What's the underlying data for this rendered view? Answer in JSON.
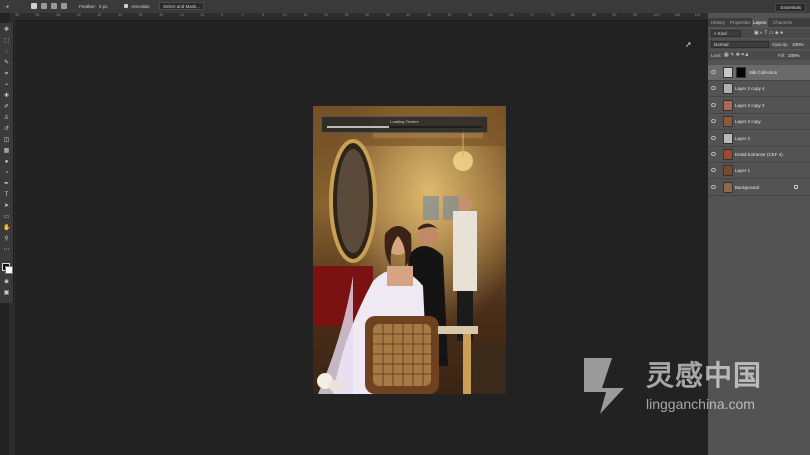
{
  "options_bar": {
    "feather_label": "Feather:",
    "feather_value": "0 px",
    "anti_alias_label": "Anti-alias",
    "select_mask_label": "Select and Mask..."
  },
  "workspace": {
    "label": "Essentials"
  },
  "ruler": {
    "top_numbers": [
      "35",
      "50",
      "45",
      "40",
      "35",
      "30",
      "25",
      "20",
      "15",
      "10",
      "5",
      "0",
      "5",
      "10",
      "15",
      "20",
      "25",
      "30",
      "35",
      "40",
      "45",
      "50",
      "55",
      "60",
      "65",
      "70",
      "75",
      "80",
      "85",
      "90",
      "95",
      "100",
      "105",
      "110"
    ]
  },
  "loading": {
    "label": "Loading Texture",
    "progress": 0.4
  },
  "panel": {
    "tabs": [
      "History",
      "Properties",
      "Layers",
      "Channels"
    ],
    "active_tab": "Layers",
    "kind_label": "Kind",
    "blend_mode": "Normal",
    "opacity_label": "Opacity:",
    "opacity_value": "100%",
    "lock_label": "Lock:",
    "fill_label": "Fill:",
    "fill_value": "100%",
    "layers": [
      {
        "name": "Silk Collection",
        "selected": true,
        "thumb": "#c8c8c8"
      },
      {
        "name": "Layer 2 copy 4",
        "selected": false,
        "thumb": "#b0b0b0"
      },
      {
        "name": "Layer 2 copy 3",
        "selected": false,
        "thumb": "#a86a5a"
      },
      {
        "name": "Layer 2 copy",
        "selected": false,
        "thumb": "#8a5a3a"
      },
      {
        "name": "Layer 2",
        "selected": false,
        "thumb": "#bbbbbb"
      },
      {
        "name": "Detail Extractor (CEF 4)",
        "selected": false,
        "thumb": "#9a4a30"
      },
      {
        "name": "Layer 1",
        "selected": false,
        "thumb": "#7a4a2a"
      },
      {
        "name": "Background",
        "selected": false,
        "thumb": "#8a6a4a"
      }
    ]
  },
  "watermark": {
    "chinese": "灵感中国",
    "url": "lingganchina.com"
  },
  "colors": {
    "panel_bg": "#535353",
    "canvas_bg": "#232323",
    "toolbar_bg": "#3a3a3a"
  }
}
